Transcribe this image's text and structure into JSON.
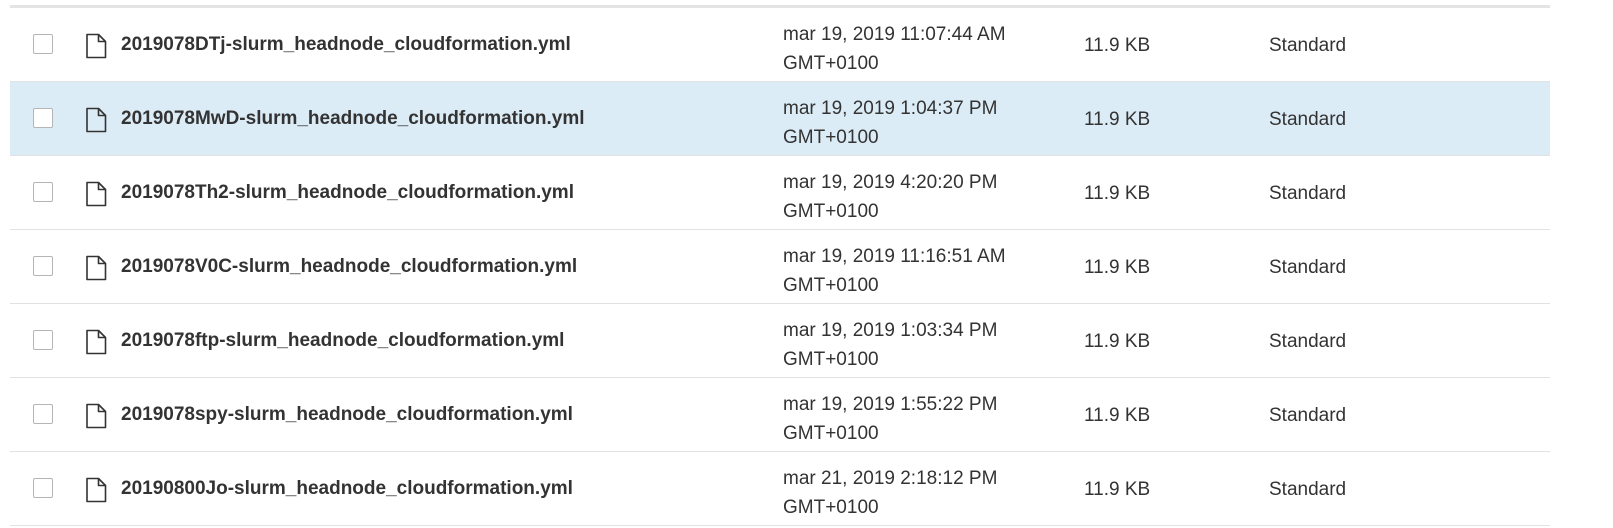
{
  "colors": {
    "selected_row_bg": "#dcecf7",
    "row_divider": "#e2e2e2"
  },
  "rows": [
    {
      "name": "2019078DTj-slurm_headnode_cloudformation.yml",
      "date_line1": "mar 19, 2019 11:07:44 AM",
      "date_line2": "GMT+0100",
      "size": "11.9 KB",
      "storage_class": "Standard",
      "icon": "file-icon",
      "checked": false,
      "highlighted": false
    },
    {
      "name": "2019078MwD-slurm_headnode_cloudformation.yml",
      "date_line1": "mar 19, 2019 1:04:37 PM",
      "date_line2": "GMT+0100",
      "size": "11.9 KB",
      "storage_class": "Standard",
      "icon": "file-icon",
      "checked": false,
      "highlighted": true
    },
    {
      "name": "2019078Th2-slurm_headnode_cloudformation.yml",
      "date_line1": "mar 19, 2019 4:20:20 PM",
      "date_line2": "GMT+0100",
      "size": "11.9 KB",
      "storage_class": "Standard",
      "icon": "file-icon",
      "checked": false,
      "highlighted": false
    },
    {
      "name": "2019078V0C-slurm_headnode_cloudformation.yml",
      "date_line1": "mar 19, 2019 11:16:51 AM",
      "date_line2": "GMT+0100",
      "size": "11.9 KB",
      "storage_class": "Standard",
      "icon": "file-icon",
      "checked": false,
      "highlighted": false
    },
    {
      "name": "2019078ftp-slurm_headnode_cloudformation.yml",
      "date_line1": "mar 19, 2019 1:03:34 PM",
      "date_line2": "GMT+0100",
      "size": "11.9 KB",
      "storage_class": "Standard",
      "icon": "file-icon",
      "checked": false,
      "highlighted": false
    },
    {
      "name": "2019078spy-slurm_headnode_cloudformation.yml",
      "date_line1": "mar 19, 2019 1:55:22 PM",
      "date_line2": "GMT+0100",
      "size": "11.9 KB",
      "storage_class": "Standard",
      "icon": "file-icon",
      "checked": false,
      "highlighted": false
    },
    {
      "name": "20190800Jo-slurm_headnode_cloudformation.yml",
      "date_line1": "mar 21, 2019 2:18:12 PM",
      "date_line2": "GMT+0100",
      "size": "11.9 KB",
      "storage_class": "Standard",
      "icon": "file-icon",
      "checked": false,
      "highlighted": false
    }
  ]
}
